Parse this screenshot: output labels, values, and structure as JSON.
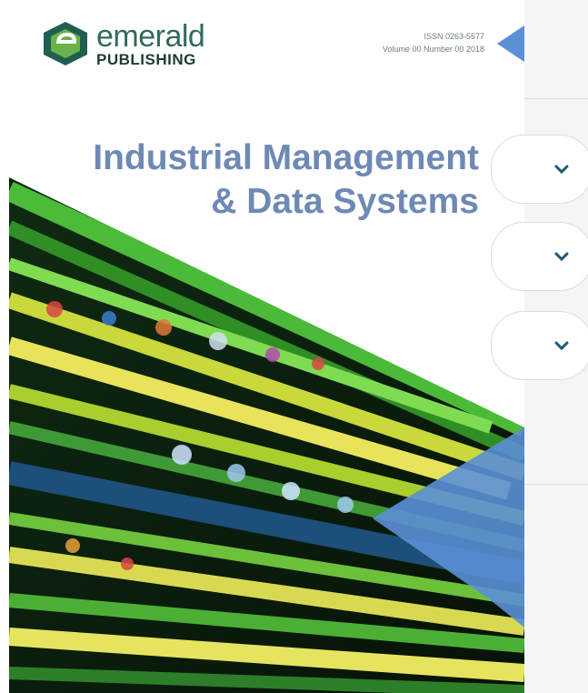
{
  "cover": {
    "publisher_name": "emerald",
    "publisher_sub": "PUBLISHING",
    "issn_line": "ISSN 0263-5577",
    "volume_line": "Volume 00 Number 00 2018",
    "title_line1": "Industrial Management",
    "title_line2": "& Data Systems"
  },
  "accordions": [
    {
      "icon": "chevron-down-icon"
    },
    {
      "icon": "chevron-down-icon"
    },
    {
      "icon": "chevron-down-icon"
    }
  ],
  "colors": {
    "title": "#6e89b5",
    "accent_blue": "#5b8fd6",
    "chevron": "#1c5a72"
  }
}
